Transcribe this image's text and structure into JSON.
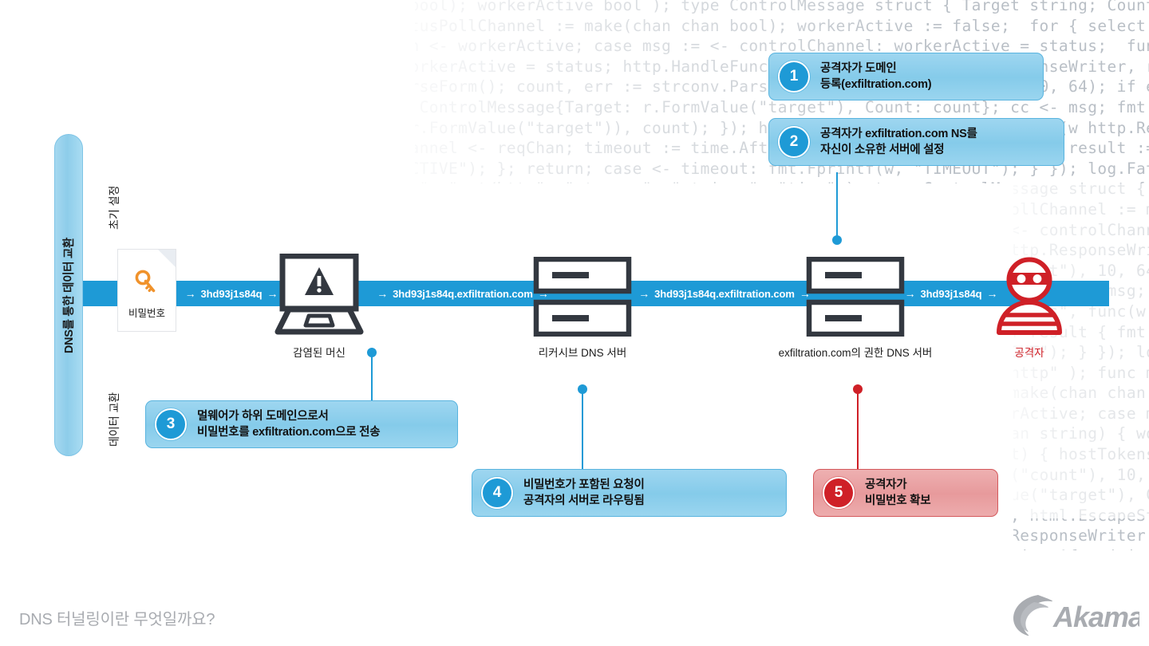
{
  "footer": {
    "title": "DNS 터널링이란 무엇일까요?",
    "logo_text": "Akamai",
    "logo_name": "akamai-logo"
  },
  "left_rail": {
    "pill_label": "DNS를 통한 데이터 교환",
    "phase_labels": [
      "초기 설정",
      "데이터 교환"
    ]
  },
  "flow": {
    "segments": [
      {
        "arrow_left": "→",
        "label": "3hd93j1s84q",
        "arrow_right": "→"
      },
      {
        "arrow_left": "→",
        "label": "3hd93j1s84q.exfiltration.com",
        "arrow_right": "→"
      },
      {
        "arrow_left": "→",
        "label": "3hd93j1s84q.exfiltration.com",
        "arrow_right": "→"
      },
      {
        "arrow_left": "→",
        "label": "3hd93j1s84q",
        "arrow_right": "→"
      }
    ],
    "bar_color": "#1e9ad6"
  },
  "nodes": {
    "password_doc": {
      "caption": "비밀번호",
      "icon": "key-icon"
    },
    "infected_machine": {
      "caption": "감염된 머신",
      "icon": "laptop-warning-icon"
    },
    "recursive_dns": {
      "caption": "리커시브\nDNS 서버",
      "icon": "server-icon"
    },
    "authoritative_dns": {
      "caption": "exfiltration.com의 권한\nDNS 서버",
      "icon": "server-icon"
    },
    "attacker": {
      "caption": "공격자",
      "icon": "attacker-icon",
      "color": "#cf2027"
    }
  },
  "callouts": [
    {
      "number": "1",
      "text": "공격자가 도메인\n등록(exfiltration.com)",
      "variant": "blue"
    },
    {
      "number": "2",
      "text": "공격자가 exfiltration.com NS를\n자신이 소유한 서버에 설정",
      "variant": "blue"
    },
    {
      "number": "3",
      "text": "멀웨어가 하위 도메인으로서\n비밀번호를 exfiltration.com으로 전송",
      "variant": "blue"
    },
    {
      "number": "4",
      "text": "비밀번호가 포함된 요청이\n공격자의 서버로 라우팅됨",
      "variant": "blue"
    },
    {
      "number": "5",
      "text": "공격자가\n비밀번호 확보",
      "variant": "red"
    }
  ],
  "colors": {
    "accent_blue": "#1e9ad6",
    "callout_blue": "#8ecdea",
    "accent_red": "#cf2027",
    "callout_red": "#e79a9c",
    "icon_dark": "#333840",
    "key_orange": "#f0922b"
  },
  "background_code": {
    "language": "go",
    "lines": [
      "    statusPollChannel = make(chan chan bool); workerActive bool ); type ControlMessage struct { Target string; Count int64; };",
      "        reqChan := make(chan bool); statusPollChannel := make(chan chan bool); workerActive := false;  for { select { case respChan",
      "      := <- statusPollChannel:  respChan <- workerActive; case msg := <- controlChannel: workerActive = status;  func admin(cc chan",
      "    ControlMessage, sc chan string) { workerActive = status; http.HandleFunc(\"/admin\", func(w http.ResponseWriter, r *http.Request) { hostTokens",
      "    := strings.Split(r.Host, \":\"); r.ParseForm(); count, err := strconv.ParseInt(r.FormValue(\"count\"), 10, 64); if err != nil { fmt.Fprintf(w,",
      "       err.Error()); return; };  msg := ControlMessage{Target: r.FormValue(\"target\"), Count: count}; cc <- msg; fmt.Fprintf(w, \"Control message issued for Target",
      "      %s, count %d\", html.EscapeString(r.FormValue(\"target\")), count); }); http.HandleFunc(\"/status\", func(w http.ResponseWriter, r *http.Request) { reqChan",
      "       := make(chan bool); statusPollChannel <- reqChan; timeout := time.After(time.Second); select { case result := <- reqChan: if result { fmt.Fprintf(w, \"ACTIVE\" );",
      "           } else { fmt.Fprintf(w, \"INACTIVE\"); }; return; case <- timeout: fmt.Fprintf(w, \"TIMEOUT\"); } }); log.Fatal(http.ListenAndServe(\":1337\", nil)); };package",
      "      main; import ( \"fmt\"; \"html\"; \"log\"; \"net/http\"; \"strconv\"; \"strings\"; \"time\" ); type ControlMessage struct { Target string; Count int64; }; func main()",
      "        { controlChannel := make(chan ControlMessage); workerCompleteChan := make(chan bool); statusPollChannel := make(chan chan bool); workerActive := false;",
      "         for { select { case respChan := <- statusPollChannel: respChan <- workerActive; case msg := <- controlChannel:  func admin(cc chan",
      "          ControlMessage, sc chan string) { workerActive = status; http.HandleFunc(\"/admin\", func(w http.ResponseWriter, r *http.Request) { hostTokens",
      "           := strings.Split(r.Host, \":\"); r.ParseForm(); count, err := strconv.ParseInt(r.FormValue(\"count\"), 10, 64); if err != nil { fmt.Fprintf(w,",
      "            err.Error()); return; }; msg := ControlMessage{Target: r.FormValue(\"target\"), Count: count}; cc <- msg; fmt.Fprintf(w, \"issued for Target",
      "             %s, count %d\", html.EscapeString(r.FormValue(\"target\")), count); }); http.HandleFunc(\"/status\", func(w, r) { reqChan",
      "              := make(chan bool); statusPollChannel <- reqChan; select { case result := <- reqChan: if result { fmt.Fprintf(w, \"ACTIVE\"); }",
      "                } else { fmt.Fprintf(w, \"INACTIVE\"); }; return; case <- timeout: fmt.Fprintf(w, \"TIMEOUT\"); } }); log.Fatal(http.",
      "                 ListenAndServe(\":1337\", nil)); }; package main; import ( \"fmt\"; \"html\"; \"log\"; \"net/http\" ); func main() { cc := make",
      "                  (chan ControlMessage); workerCompleteChan := make(chan bool); statusPollChannel := make(chan chan bool); workerActive",
      "                    := false; for { select { case respChan := <- statusPollChannel: respChan <- workerActive; case msg := <- cc;",
      "                      controlChannel: workerActive = status; func admin(cc chan ControlMessage, sc chan string) { workerActive",
      "                       = status; http.HandleFunc(\"/admin\", func(w http.ResponseWriter, r *http.Request) { hostTokens := strings.",
      "                        Split(r.Host, \":\"); r.ParseForm(); count, err := strconv.ParseInt(r.FormValue(\"count\"), 10, 64); if err != nil { fmt.",
      "                          Fprintf(w, err.Error()); return; }; msg := ControlMessage{Target: r.FormValue(\"target\"), Count: count};",
      "                           cc <- msg; fmt.Fprintf(w, \"Control message issued for Target %s, count %d\", html.EscapeString(r.",
      "                            FormValue(\"target\")), count); }); http.HandleFunc(\"/status\", func(w http.ResponseWriter, r *http.Request)",
      "                              { reqChan := make(chan bool); statusPollChannel <- reqChan; timeout := time.After(time.Second);"
    ]
  }
}
